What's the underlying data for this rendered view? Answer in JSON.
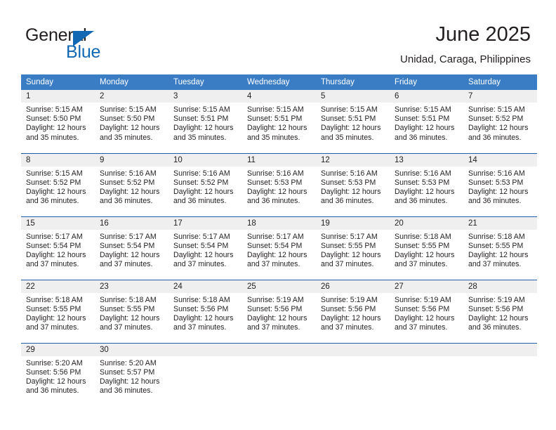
{
  "brand": {
    "name_part1": "General",
    "name_part2": "Blue",
    "accent_color": "#1268b3"
  },
  "header": {
    "title": "June 2025",
    "subtitle": "Unidad, Caraga, Philippines"
  },
  "calendar": {
    "header_bg": "#3b7dc4",
    "row_divider_color": "#1f5fa8",
    "daynum_bg": "#efefef",
    "weekdays": [
      "Sunday",
      "Monday",
      "Tuesday",
      "Wednesday",
      "Thursday",
      "Friday",
      "Saturday"
    ],
    "weeks": [
      [
        {
          "day": "1",
          "sunrise": "Sunrise: 5:15 AM",
          "sunset": "Sunset: 5:50 PM",
          "daylight": "Daylight: 12 hours and 35 minutes."
        },
        {
          "day": "2",
          "sunrise": "Sunrise: 5:15 AM",
          "sunset": "Sunset: 5:50 PM",
          "daylight": "Daylight: 12 hours and 35 minutes."
        },
        {
          "day": "3",
          "sunrise": "Sunrise: 5:15 AM",
          "sunset": "Sunset: 5:51 PM",
          "daylight": "Daylight: 12 hours and 35 minutes."
        },
        {
          "day": "4",
          "sunrise": "Sunrise: 5:15 AM",
          "sunset": "Sunset: 5:51 PM",
          "daylight": "Daylight: 12 hours and 35 minutes."
        },
        {
          "day": "5",
          "sunrise": "Sunrise: 5:15 AM",
          "sunset": "Sunset: 5:51 PM",
          "daylight": "Daylight: 12 hours and 35 minutes."
        },
        {
          "day": "6",
          "sunrise": "Sunrise: 5:15 AM",
          "sunset": "Sunset: 5:51 PM",
          "daylight": "Daylight: 12 hours and 36 minutes."
        },
        {
          "day": "7",
          "sunrise": "Sunrise: 5:15 AM",
          "sunset": "Sunset: 5:52 PM",
          "daylight": "Daylight: 12 hours and 36 minutes."
        }
      ],
      [
        {
          "day": "8",
          "sunrise": "Sunrise: 5:15 AM",
          "sunset": "Sunset: 5:52 PM",
          "daylight": "Daylight: 12 hours and 36 minutes."
        },
        {
          "day": "9",
          "sunrise": "Sunrise: 5:16 AM",
          "sunset": "Sunset: 5:52 PM",
          "daylight": "Daylight: 12 hours and 36 minutes."
        },
        {
          "day": "10",
          "sunrise": "Sunrise: 5:16 AM",
          "sunset": "Sunset: 5:52 PM",
          "daylight": "Daylight: 12 hours and 36 minutes."
        },
        {
          "day": "11",
          "sunrise": "Sunrise: 5:16 AM",
          "sunset": "Sunset: 5:53 PM",
          "daylight": "Daylight: 12 hours and 36 minutes."
        },
        {
          "day": "12",
          "sunrise": "Sunrise: 5:16 AM",
          "sunset": "Sunset: 5:53 PM",
          "daylight": "Daylight: 12 hours and 36 minutes."
        },
        {
          "day": "13",
          "sunrise": "Sunrise: 5:16 AM",
          "sunset": "Sunset: 5:53 PM",
          "daylight": "Daylight: 12 hours and 36 minutes."
        },
        {
          "day": "14",
          "sunrise": "Sunrise: 5:16 AM",
          "sunset": "Sunset: 5:53 PM",
          "daylight": "Daylight: 12 hours and 36 minutes."
        }
      ],
      [
        {
          "day": "15",
          "sunrise": "Sunrise: 5:17 AM",
          "sunset": "Sunset: 5:54 PM",
          "daylight": "Daylight: 12 hours and 37 minutes."
        },
        {
          "day": "16",
          "sunrise": "Sunrise: 5:17 AM",
          "sunset": "Sunset: 5:54 PM",
          "daylight": "Daylight: 12 hours and 37 minutes."
        },
        {
          "day": "17",
          "sunrise": "Sunrise: 5:17 AM",
          "sunset": "Sunset: 5:54 PM",
          "daylight": "Daylight: 12 hours and 37 minutes."
        },
        {
          "day": "18",
          "sunrise": "Sunrise: 5:17 AM",
          "sunset": "Sunset: 5:54 PM",
          "daylight": "Daylight: 12 hours and 37 minutes."
        },
        {
          "day": "19",
          "sunrise": "Sunrise: 5:17 AM",
          "sunset": "Sunset: 5:55 PM",
          "daylight": "Daylight: 12 hours and 37 minutes."
        },
        {
          "day": "20",
          "sunrise": "Sunrise: 5:18 AM",
          "sunset": "Sunset: 5:55 PM",
          "daylight": "Daylight: 12 hours and 37 minutes."
        },
        {
          "day": "21",
          "sunrise": "Sunrise: 5:18 AM",
          "sunset": "Sunset: 5:55 PM",
          "daylight": "Daylight: 12 hours and 37 minutes."
        }
      ],
      [
        {
          "day": "22",
          "sunrise": "Sunrise: 5:18 AM",
          "sunset": "Sunset: 5:55 PM",
          "daylight": "Daylight: 12 hours and 37 minutes."
        },
        {
          "day": "23",
          "sunrise": "Sunrise: 5:18 AM",
          "sunset": "Sunset: 5:55 PM",
          "daylight": "Daylight: 12 hours and 37 minutes."
        },
        {
          "day": "24",
          "sunrise": "Sunrise: 5:18 AM",
          "sunset": "Sunset: 5:56 PM",
          "daylight": "Daylight: 12 hours and 37 minutes."
        },
        {
          "day": "25",
          "sunrise": "Sunrise: 5:19 AM",
          "sunset": "Sunset: 5:56 PM",
          "daylight": "Daylight: 12 hours and 37 minutes."
        },
        {
          "day": "26",
          "sunrise": "Sunrise: 5:19 AM",
          "sunset": "Sunset: 5:56 PM",
          "daylight": "Daylight: 12 hours and 37 minutes."
        },
        {
          "day": "27",
          "sunrise": "Sunrise: 5:19 AM",
          "sunset": "Sunset: 5:56 PM",
          "daylight": "Daylight: 12 hours and 37 minutes."
        },
        {
          "day": "28",
          "sunrise": "Sunrise: 5:19 AM",
          "sunset": "Sunset: 5:56 PM",
          "daylight": "Daylight: 12 hours and 36 minutes."
        }
      ],
      [
        {
          "day": "29",
          "sunrise": "Sunrise: 5:20 AM",
          "sunset": "Sunset: 5:56 PM",
          "daylight": "Daylight: 12 hours and 36 minutes."
        },
        {
          "day": "30",
          "sunrise": "Sunrise: 5:20 AM",
          "sunset": "Sunset: 5:57 PM",
          "daylight": "Daylight: 12 hours and 36 minutes."
        },
        {
          "day": "",
          "sunrise": "",
          "sunset": "",
          "daylight": ""
        },
        {
          "day": "",
          "sunrise": "",
          "sunset": "",
          "daylight": ""
        },
        {
          "day": "",
          "sunrise": "",
          "sunset": "",
          "daylight": ""
        },
        {
          "day": "",
          "sunrise": "",
          "sunset": "",
          "daylight": ""
        },
        {
          "day": "",
          "sunrise": "",
          "sunset": "",
          "daylight": ""
        }
      ]
    ]
  }
}
